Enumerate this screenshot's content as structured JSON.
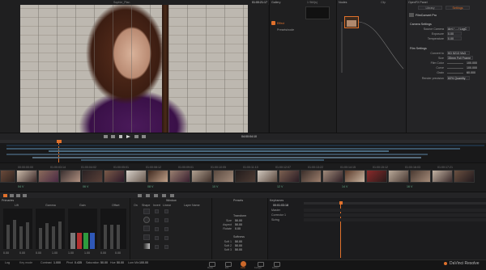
{
  "window": {
    "app_name": "DaVinci Resolve"
  },
  "viewer": {
    "clip_name": "Sophie_Plan",
    "timecode": "01:00:21:17"
  },
  "gallery": {
    "tab_label": "Gallery",
    "stills_label": "1 Still(s)"
  },
  "nodes": {
    "tab_label": "Nodes",
    "clip_label": "Clip"
  },
  "openfx": {
    "tab_label": "OpenFX Panel",
    "tabs": [
      "Library",
      "Settings"
    ],
    "plugin_name": "FilmConvert Pro",
    "sections": [
      {
        "title": "Camera Settings",
        "rows": [
          {
            "label": "Source Camera",
            "value": "Arri / ... / LogC"
          },
          {
            "label": "Exposure",
            "value": "0.00"
          },
          {
            "label": "Temperature",
            "value": "0.00"
          }
        ]
      },
      {
        "title": "Film Settings",
        "rows": [
          {
            "label": "Convert to",
            "value": "KD 5213 Vis3"
          },
          {
            "label": "Size",
            "value": "35mm Full Frame"
          },
          {
            "label": "Film Color",
            "value": "100.000"
          },
          {
            "label": "Curve",
            "value": "100.000"
          },
          {
            "label": "Grain",
            "value": "60.000"
          },
          {
            "label": "Render precision",
            "value": "60% Quantity"
          }
        ]
      }
    ]
  },
  "tree": {
    "items": [
      "Effect",
      "Presets/node"
    ]
  },
  "transport": {
    "timecode": "04:00:04:10"
  },
  "thumbnails": [
    {
      "tc": "00:00:00:00",
      "label": "04 V"
    },
    {
      "tc": "01:00:03:14",
      "label": "05 V"
    },
    {
      "tc": "01:00:04:02",
      "label": "06 V"
    },
    {
      "tc": "01:00:05:01",
      "label": "07 V"
    },
    {
      "tc": "01:00:08:12",
      "label": "08 V"
    },
    {
      "tc": "01:00:09:01",
      "label": "09 V"
    },
    {
      "tc": "01:00:10:05",
      "label": "10 V"
    },
    {
      "tc": "01:00:11:10",
      "label": "11 V"
    },
    {
      "tc": "01:00:12:07",
      "label": "12 V"
    },
    {
      "tc": "01:00:13:22",
      "label": "13 V"
    },
    {
      "tc": "01:00:14:15",
      "label": "14 V"
    },
    {
      "tc": "01:00:15:12",
      "label": "15 V"
    },
    {
      "tc": "01:00:16:03",
      "label": "16 V"
    },
    {
      "tc": "01:00:17:21",
      "label": "17 V"
    },
    {
      "tc": "01:00:18:09",
      "label": "18 V"
    },
    {
      "tc": "01:00:19:01",
      "label": "19 V"
    },
    {
      "tc": "01:00:20:05",
      "label": "20 V"
    },
    {
      "tc": "01:00:21:11",
      "label": "21 V"
    },
    {
      "tc": "01:00:22:00",
      "label": "22 V"
    },
    {
      "tc": "01:00:23:02",
      "label": "23 V"
    },
    {
      "tc": "01:00:24:17",
      "label": "24 V"
    },
    {
      "tc": "01:00:25:09",
      "label": "25 V"
    }
  ],
  "scopes": {
    "title": "Primaries",
    "wheel_labels": [
      "Lift",
      "Gamma",
      "Gain",
      "Offset"
    ],
    "meter_values": [
      "0.00",
      "0.00",
      "0.00",
      "1.00",
      "1.00",
      "1.00",
      "0.00",
      "0.00"
    ]
  },
  "layers": {
    "title": "Window",
    "cols": [
      "On",
      "Shape",
      "Invert",
      "Linear",
      "Layer Name"
    ],
    "rows": [
      "Linear",
      "Circle",
      "Polygon",
      "Curve",
      "Gradient"
    ]
  },
  "presets": {
    "title": "Presets",
    "label1": "Transform",
    "fields1": [
      {
        "label": "Size",
        "value": "50.00"
      },
      {
        "label": "Aspect",
        "value": "50.00"
      },
      {
        "label": "Rotate",
        "value": "0.00"
      }
    ],
    "label2": "Softness",
    "fields2": [
      {
        "label": "Soft 1",
        "value": "50.00"
      },
      {
        "label": "Soft 2",
        "value": "50.00"
      },
      {
        "label": "Soft 3",
        "value": "50.00"
      }
    ]
  },
  "keyframes": {
    "title": "Keyframes",
    "timecode": "00:01:03:18",
    "tracks": [
      "Master",
      "Corrector 1",
      "Sizing"
    ]
  },
  "status": {
    "mode": "Log",
    "key_label": "Key mode",
    "items": [
      {
        "label": "Contrast",
        "value": "1.000"
      },
      {
        "label": "Pivot",
        "value": "0.435"
      },
      {
        "label": "Saturation",
        "value": "50.00"
      },
      {
        "label": "Hue",
        "value": "50.00"
      },
      {
        "label": "Lum Mix",
        "value": "100.00"
      }
    ]
  },
  "pages": [
    "Media",
    "Edit",
    "Color",
    "Fairlight",
    "Deliver"
  ],
  "colors": {
    "accent": "#e0712c",
    "bg": "#1a1a1b",
    "panel": "#1f1f20"
  }
}
